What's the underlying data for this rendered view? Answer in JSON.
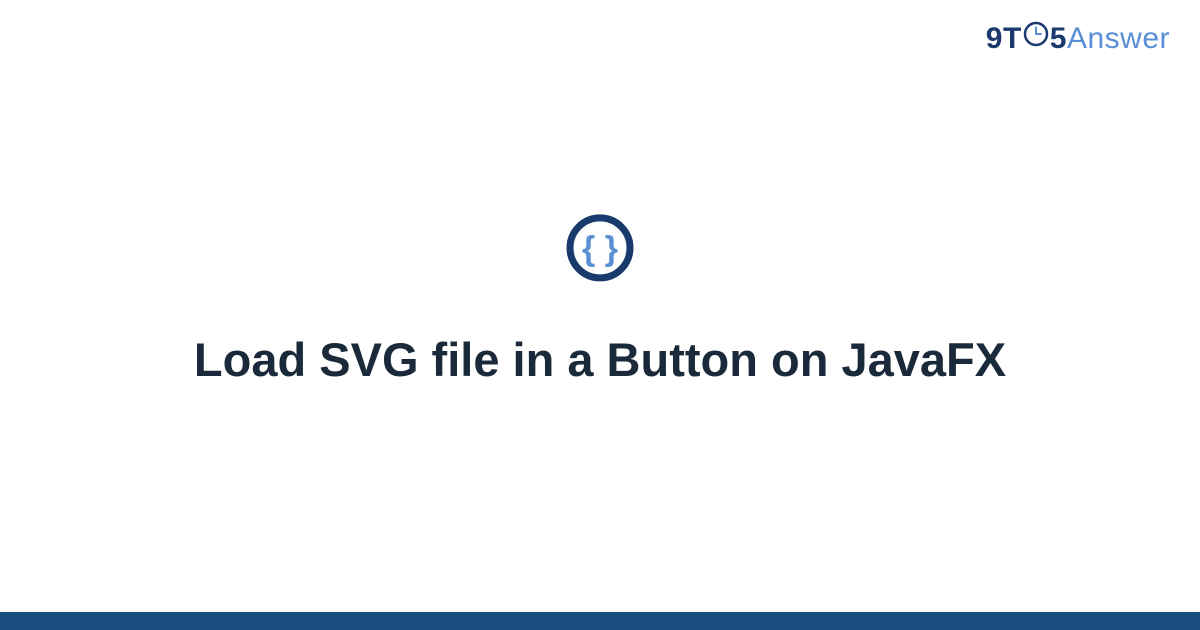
{
  "brand": {
    "part1": "9",
    "part2": "T",
    "part3": "5",
    "part4": "Answer"
  },
  "title": "Load SVG file in a Button on JavaFX",
  "colors": {
    "dark_blue": "#1a3a6e",
    "light_blue": "#5a8fd6",
    "footer_bar": "#1a4d80",
    "icon_ring": "#1a3a6e",
    "icon_braces": "#5a8fd6"
  }
}
